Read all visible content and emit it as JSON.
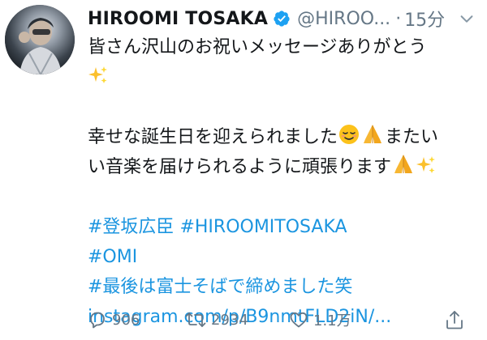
{
  "tweet": {
    "display_name": "HIROOMI TOSAKA",
    "handle": "@HIROO...",
    "time_separator": "·",
    "time": "15分",
    "text_lines": {
      "l1": "皆さん沢山のお祝いメッセージありがとう",
      "l3": "幸せな誕生日を迎えられました",
      "l3b": "またい",
      "l4": "い音楽を届けられるように頑張ります"
    },
    "hashtags": {
      "h1": "#登坂広臣",
      "h2": "#HIROOMITOSAKA",
      "h3": "#OMI",
      "h4": "#最後は富士そばで締めました笑"
    },
    "link": "instagram.com/p/B9nmtFLD2iN/...",
    "emoji": {
      "sparkles": "sparkles",
      "relieved": "relieved-face",
      "pray": "folded-hands"
    }
  },
  "actions": {
    "reply_count": "906",
    "retweet_count": "2934",
    "like_count": "1.1万"
  },
  "colors": {
    "link": "#1b95e0",
    "secondary": "#657786",
    "verified": "#1da1f2"
  }
}
